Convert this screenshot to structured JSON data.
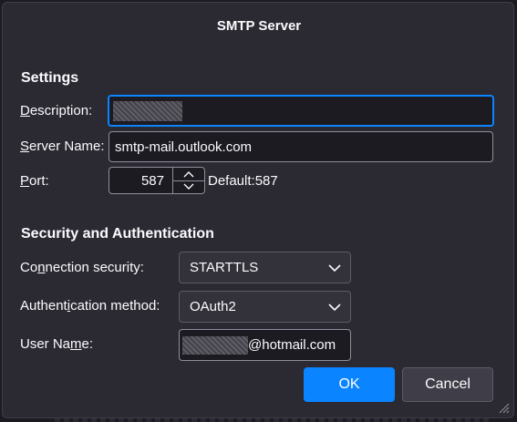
{
  "dialog": {
    "title": "SMTP Server"
  },
  "settings": {
    "heading": "Settings",
    "description": {
      "label_access_key": "D",
      "label_rest": "escription:",
      "value": ""
    },
    "server_name": {
      "label_access_key": "S",
      "label_rest": "erver Name:",
      "value": "smtp-mail.outlook.com"
    },
    "port": {
      "label_access_key": "P",
      "label_rest": "ort:",
      "value": "587",
      "default_text": "Default:587"
    }
  },
  "security": {
    "heading": "Security and Authentication",
    "connection_security": {
      "label_before": "Co",
      "label_access_key": "n",
      "label_after": "nection security:",
      "selected": "STARTTLS"
    },
    "auth_method": {
      "label_before": "Authent",
      "label_access_key": "i",
      "label_after": "cation method:",
      "selected": "OAuth2"
    },
    "user_name": {
      "label_before": "User Na",
      "label_access_key": "m",
      "label_after": "e:",
      "value_suffix": "@hotmail.com"
    }
  },
  "buttons": {
    "ok": "OK",
    "cancel": "Cancel"
  },
  "icons": {
    "spin_up": "chevron-up-icon",
    "spin_down": "chevron-down-icon",
    "select_arrow": "chevron-down-icon",
    "resize": "resize-grip-icon"
  },
  "colors": {
    "accent": "#0a84ff",
    "dialog_bg": "#2b2a33",
    "field_bg": "#1c1b22"
  }
}
